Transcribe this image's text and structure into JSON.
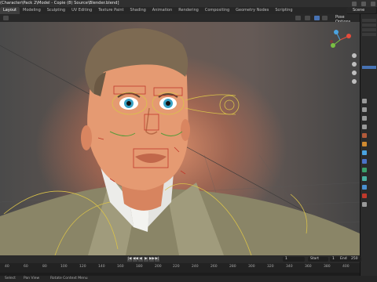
{
  "window": {
    "title": "(Character\\Pack 2\\Model - Copie (8) Source\\Blender.blend]"
  },
  "workspaces": [
    "Layout",
    "Modeling",
    "Sculpting",
    "UV Editing",
    "Texture Paint",
    "Shading",
    "Animation",
    "Rendering",
    "Compositing",
    "Geometry Nodes",
    "Scripting"
  ],
  "active_workspace": "Layout",
  "scene": {
    "name": "Scene"
  },
  "viewport_header": {
    "pose_options": "Pose Options"
  },
  "timeline": {
    "current_frame": "1",
    "start_label": "Start",
    "start_value": "1",
    "end_label": "End",
    "end_value": "250",
    "ruler": [
      "40",
      "60",
      "80",
      "100",
      "120",
      "140",
      "160",
      "180",
      "200",
      "220",
      "240",
      "260",
      "280",
      "300",
      "320",
      "340",
      "360",
      "380",
      "400"
    ]
  },
  "statusbar": {
    "left": "Select",
    "middle": "Pan View",
    "right": "Rotate Context Menu"
  },
  "colors": {
    "accent": "#4772b3",
    "rig_yellow": "#d9c24a",
    "rig_red": "#c0392b"
  }
}
